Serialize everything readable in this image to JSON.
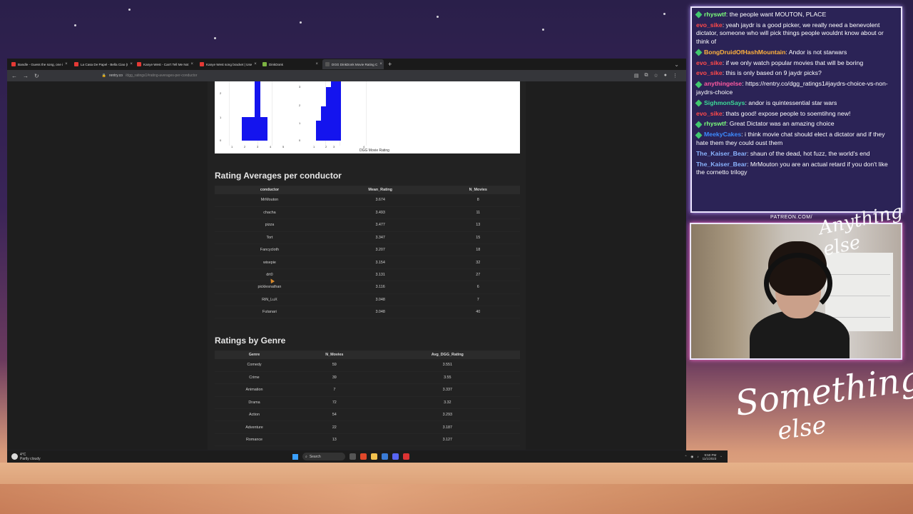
{
  "browser": {
    "tabs": [
      {
        "label": "Bandle - Guess the song, one i",
        "color": "#e53935"
      },
      {
        "label": "La Casa De Papel - Bella Ciao (I",
        "color": "#e53935"
      },
      {
        "label": "Kanye West - Can't Tell Me Not",
        "color": "#e53935"
      },
      {
        "label": "Kanye West song bracket | Use",
        "color": "#e53935"
      },
      {
        "label": "DinkDonk",
        "color": "#7cb342"
      },
      {
        "label": "DGG DinkDonk Movie Rating C",
        "color": "#555555"
      }
    ],
    "url_host": "rentry.co",
    "url_path": "/dgg_ratings1#rating-averages-per-conductor"
  },
  "chart_snippet": {
    "left_ticks_y": [
      "2",
      "1",
      "0"
    ],
    "left_ticks_x": [
      "1",
      "2",
      "3",
      "4",
      "5"
    ],
    "right_ticks_y": [
      "3",
      "2",
      "1",
      "0"
    ],
    "right_ticks_x": [
      "1",
      "2",
      "3",
      "4"
    ],
    "xlabel": "DGG Movie Rating"
  },
  "conductor_section": {
    "title": "Rating Averages per conductor",
    "headers": [
      "conductor",
      "Mean_Rating",
      "N_Movies"
    ],
    "rows": [
      [
        "MrMouton",
        "3.674",
        "8"
      ],
      [
        "chacha",
        "3.493",
        "11"
      ],
      [
        "pizza",
        "3.477",
        "13"
      ],
      [
        "Tort",
        "3.347",
        "15"
      ],
      [
        "Fancycloth",
        "3.207",
        "18"
      ],
      [
        "wisepie",
        "3.154",
        "32"
      ],
      [
        "drt0",
        "3.131",
        "27"
      ],
      [
        "picklesnathan",
        "3.116",
        "6"
      ],
      [
        "RiN_LuX",
        "3.048",
        "7"
      ],
      [
        "Futanari",
        "3.048",
        "40"
      ]
    ]
  },
  "genre_section": {
    "title": "Ratings by Genre",
    "headers": [
      "Genre",
      "N_Movies",
      "Avg_DGG_Rating"
    ],
    "rows": [
      [
        "Comedy",
        "59",
        "3.551"
      ],
      [
        "Crime",
        "39",
        "3.55"
      ],
      [
        "Animation",
        "7",
        "3.337"
      ],
      [
        "Drama",
        "72",
        "3.32"
      ],
      [
        "Action",
        "54",
        "3.293"
      ],
      [
        "Adventure",
        "22",
        "3.187"
      ],
      [
        "Romance",
        "13",
        "3.127"
      ]
    ]
  },
  "taskbar": {
    "temp": "4°C",
    "weather": "Partly cloudy",
    "search": "Search",
    "time": "9:50 PM",
    "date": "11/1/2023"
  },
  "chat": [
    {
      "user": "rhyswtf",
      "text": "the people want MOUTON, PLACE",
      "color": "#7dff7d",
      "badge": true
    },
    {
      "user": "evo_sike",
      "text": "yeah jaydr is a good picker, we really need a benevolent dictator, someone who will pick things people wouldnt know about or think of",
      "color": "#ff4a4a",
      "badge": false
    },
    {
      "user": "BongDruidOfHashMountain",
      "text": "Andor is not starwars",
      "color": "#ffb23d",
      "badge": true
    },
    {
      "user": "evo_sike",
      "text": "if we only watch popular movies that will be boring",
      "color": "#ff4a4a",
      "badge": false
    },
    {
      "user": "evo_sike",
      "text": "this is only based on 9 jaydr picks?",
      "color": "#ff4a4a",
      "badge": false
    },
    {
      "user": "anythingelse",
      "text": "https://rentry.co/dgg_ratings1#jaydrs-choice-vs-non-jaydrs-choice",
      "color": "#ff5aa0",
      "badge": true
    },
    {
      "user": "SighmonSays",
      "text": "andor is quintessential star wars",
      "color": "#3ddc97",
      "badge": true
    },
    {
      "user": "evo_sike",
      "text": "thats good! expose people to soemtihng new!",
      "color": "#ff4a4a",
      "badge": false
    },
    {
      "user": "rhyswtf",
      "text": "Great Dictator was an amazing choice",
      "color": "#7dff7d",
      "badge": true
    },
    {
      "user": "MeekyCakes",
      "text": "i think movie chat should elect a dictator and if they hate them they could oust them",
      "color": "#3d8bff",
      "badge": true
    },
    {
      "user": "The_Kaiser_Bear",
      "text": "shaun of the dead, hot fuzz, the world's end",
      "color": "#8ab4ff",
      "badge": false
    },
    {
      "user": "The_Kaiser_Bear",
      "text": "MrMouton you are an actual retard if you don't like the cornetto trilogy",
      "color": "#8ab4ff",
      "badge": false
    }
  ],
  "overlay": {
    "patreon": "PATREON.COM/",
    "brand_top": "Anything else",
    "brand_line1": "Something",
    "brand_line2": "else"
  },
  "colors": {
    "chart_bar": "#1414ee",
    "chat_bg": "#2b2356"
  }
}
